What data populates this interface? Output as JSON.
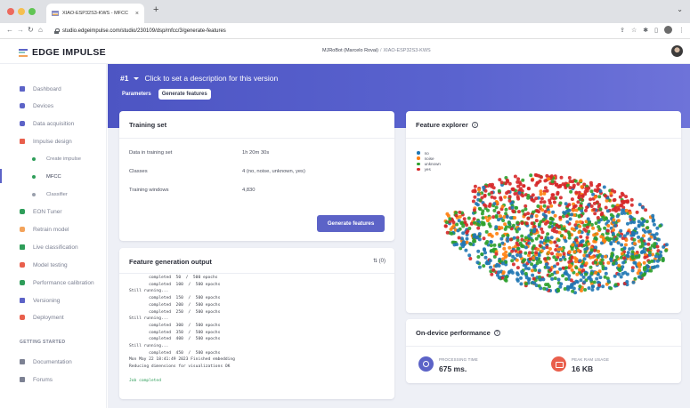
{
  "browser": {
    "tab_title": "XIAO-ESP32S3-KWS - MFCC",
    "tab_close": "×",
    "new_tab": "+",
    "tabs_menu": "⌄",
    "url": "studio.edgeimpulse.com/studio/230109/dsp/mfcc/3/generate-features"
  },
  "header": {
    "logo_text": "EDGE IMPULSE",
    "user": "MJRoBot (Marcelo Rovai)",
    "separator": "/",
    "project": "XIAO-ESP32S3-KWS"
  },
  "sidebar": {
    "items": [
      {
        "label": "Dashboard",
        "icon": "monitor-icon",
        "color": "#5c63c7"
      },
      {
        "label": "Devices",
        "icon": "devices-icon",
        "color": "#5c63c7"
      },
      {
        "label": "Data acquisition",
        "icon": "database-icon",
        "color": "#5c63c7"
      },
      {
        "label": "Impulse design",
        "icon": "pulse-icon",
        "color": "#e95f4c"
      },
      {
        "label": "EON Tuner",
        "icon": "tuner-icon",
        "color": "#2e9d59"
      },
      {
        "label": "Retrain model",
        "icon": "retrain-icon",
        "color": "#f3a35b"
      },
      {
        "label": "Live classification",
        "icon": "live-icon",
        "color": "#2e9d59"
      },
      {
        "label": "Model testing",
        "icon": "testing-icon",
        "color": "#e95f4c"
      },
      {
        "label": "Performance calibration",
        "icon": "calibration-icon",
        "color": "#2e9d59"
      },
      {
        "label": "Versioning",
        "icon": "versioning-icon",
        "color": "#5c63c7"
      },
      {
        "label": "Deployment",
        "icon": "deployment-icon",
        "color": "#e95f4c"
      }
    ],
    "sub_items": [
      {
        "label": "Create impulse"
      },
      {
        "label": "MFCC"
      },
      {
        "label": "Classifier"
      }
    ],
    "getting_started": "GETTING STARTED",
    "help_items": [
      {
        "label": "Documentation",
        "icon": "documentation-icon"
      },
      {
        "label": "Forums",
        "icon": "forums-icon"
      }
    ]
  },
  "hero": {
    "version": "#1",
    "description": "Click to set a description for this version",
    "tabs": [
      "Parameters",
      "Generate features"
    ]
  },
  "training_set": {
    "title": "Training set",
    "rows": [
      {
        "label": "Data in training set",
        "value": "1h 20m 30s"
      },
      {
        "label": "Classes",
        "value": "4 (no, noise, unknown, yes)"
      },
      {
        "label": "Training windows",
        "value": "4,830"
      }
    ],
    "button": "Generate features"
  },
  "output": {
    "title": "Feature generation output",
    "count": "(0)",
    "log_lines": [
      "        completed  50  /  500 epochs",
      "        completed  100  /  500 epochs",
      "Still running...",
      "        completed  150  /  500 epochs",
      "        completed  200  /  500 epochs",
      "        completed  250  /  500 epochs",
      "Still running...",
      "        completed  300  /  500 epochs",
      "        completed  350  /  500 epochs",
      "        completed  400  /  500 epochs",
      "Still running...",
      "        completed  450  /  500 epochs",
      "Mon May 22 18:41:49 2023 Finished embedding",
      "Reducing dimensions for visualizations OK",
      "",
      "Job completed"
    ]
  },
  "explorer": {
    "title": "Feature explorer",
    "info": "i"
  },
  "chart_data": {
    "type": "scatter",
    "title": "",
    "legend_position": "top-left",
    "series": [
      {
        "name": "no",
        "color": "#1f77b4"
      },
      {
        "name": "noise",
        "color": "#ff7f0e"
      },
      {
        "name": "unknown",
        "color": "#2ca02c"
      },
      {
        "name": "yes",
        "color": "#d62728"
      }
    ]
  },
  "performance": {
    "title": "On-device performance",
    "help": "?",
    "metrics": [
      {
        "label": "PROCESSING TIME",
        "value": "675 ms."
      },
      {
        "label": "PEAK RAM USAGE",
        "value": "16 KB"
      }
    ]
  }
}
